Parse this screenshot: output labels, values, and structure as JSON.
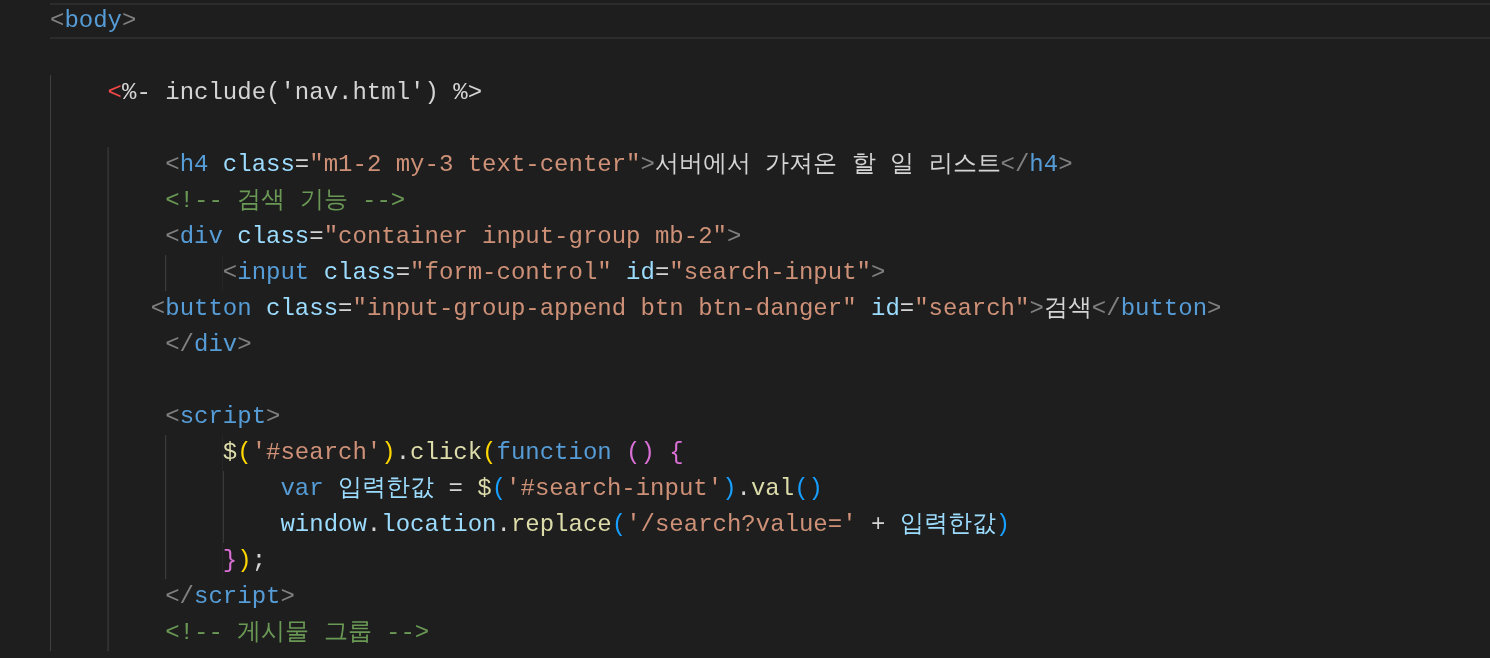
{
  "editor": {
    "lines": [
      {
        "kind": "code",
        "tokens": [
          {
            "kind": "punct",
            "text": "<"
          },
          {
            "kind": "tag",
            "text": "body"
          },
          {
            "kind": "punct",
            "text": ">"
          }
        ]
      },
      {
        "kind": "blank"
      },
      {
        "kind": "code",
        "tokens": [
          {
            "kind": "ejs",
            "text": "    <"
          },
          {
            "kind": "text",
            "text": "%- include('nav.html') %>"
          }
        ]
      },
      {
        "kind": "blank"
      },
      {
        "kind": "code",
        "tokens": [
          {
            "kind": "punct",
            "text": "        <"
          },
          {
            "kind": "tag",
            "text": "h4"
          },
          {
            "kind": "attr",
            "text": " class"
          },
          {
            "kind": "text",
            "text": "="
          },
          {
            "kind": "string",
            "text": "\"m1-2 my-3 text-center\""
          },
          {
            "kind": "punct",
            "text": ">"
          },
          {
            "kind": "text",
            "text": "서버에서 가져온 할 일 리스트"
          },
          {
            "kind": "punct",
            "text": "</"
          },
          {
            "kind": "tag",
            "text": "h4"
          },
          {
            "kind": "punct",
            "text": ">"
          }
        ]
      },
      {
        "kind": "code",
        "tokens": [
          {
            "kind": "comment",
            "text": "        <!-- 검색 기능 -->"
          }
        ]
      },
      {
        "kind": "code",
        "tokens": [
          {
            "kind": "punct",
            "text": "        <"
          },
          {
            "kind": "tag",
            "text": "div"
          },
          {
            "kind": "attr",
            "text": " class"
          },
          {
            "kind": "text",
            "text": "="
          },
          {
            "kind": "string",
            "text": "\"container input-group mb-2\""
          },
          {
            "kind": "punct",
            "text": ">"
          }
        ]
      },
      {
        "kind": "code",
        "tokens": [
          {
            "kind": "punct",
            "text": "            <"
          },
          {
            "kind": "tag",
            "text": "input"
          },
          {
            "kind": "attr",
            "text": " class"
          },
          {
            "kind": "text",
            "text": "="
          },
          {
            "kind": "string",
            "text": "\"form-control\""
          },
          {
            "kind": "attr",
            "text": " id"
          },
          {
            "kind": "text",
            "text": "="
          },
          {
            "kind": "string",
            "text": "\"search-input\""
          },
          {
            "kind": "punct",
            "text": ">"
          }
        ]
      },
      {
        "kind": "code",
        "tokens": [
          {
            "kind": "punct",
            "text": "       <"
          },
          {
            "kind": "tag",
            "text": "button"
          },
          {
            "kind": "attr",
            "text": " class"
          },
          {
            "kind": "text",
            "text": "="
          },
          {
            "kind": "string",
            "text": "\"input-group-append btn btn-danger\""
          },
          {
            "kind": "attr",
            "text": " id"
          },
          {
            "kind": "text",
            "text": "="
          },
          {
            "kind": "string",
            "text": "\"search\""
          },
          {
            "kind": "punct",
            "text": ">"
          },
          {
            "kind": "text",
            "text": "검색"
          },
          {
            "kind": "punct",
            "text": "</"
          },
          {
            "kind": "tag",
            "text": "button"
          },
          {
            "kind": "punct",
            "text": ">"
          }
        ]
      },
      {
        "kind": "code",
        "tokens": [
          {
            "kind": "punct",
            "text": "        </"
          },
          {
            "kind": "tag",
            "text": "div"
          },
          {
            "kind": "punct",
            "text": ">"
          }
        ]
      },
      {
        "kind": "blank"
      },
      {
        "kind": "code",
        "tokens": [
          {
            "kind": "punct",
            "text": "        <"
          },
          {
            "kind": "tag",
            "text": "script"
          },
          {
            "kind": "punct",
            "text": ">"
          }
        ]
      },
      {
        "kind": "code",
        "tokens": [
          {
            "kind": "fn",
            "text": "            $"
          },
          {
            "kind": "bracket1",
            "text": "("
          },
          {
            "kind": "string",
            "text": "'#search'"
          },
          {
            "kind": "bracket1",
            "text": ")"
          },
          {
            "kind": "text",
            "text": "."
          },
          {
            "kind": "fn",
            "text": "click"
          },
          {
            "kind": "bracket1",
            "text": "("
          },
          {
            "kind": "keyword",
            "text": "function"
          },
          {
            "kind": "bracket2",
            "text": " ()"
          },
          {
            "kind": "bracket2",
            "text": " {"
          }
        ]
      },
      {
        "kind": "code",
        "tokens": [
          {
            "kind": "keyword",
            "text": "                var"
          },
          {
            "kind": "var",
            "text": " 입력한값"
          },
          {
            "kind": "text",
            "text": " = "
          },
          {
            "kind": "fn",
            "text": "$"
          },
          {
            "kind": "bracket3",
            "text": "("
          },
          {
            "kind": "string",
            "text": "'#search-input'"
          },
          {
            "kind": "bracket3",
            "text": ")"
          },
          {
            "kind": "text",
            "text": "."
          },
          {
            "kind": "fn",
            "text": "val"
          },
          {
            "kind": "bracket3",
            "text": "()"
          }
        ]
      },
      {
        "kind": "code",
        "tokens": [
          {
            "kind": "var",
            "text": "                window"
          },
          {
            "kind": "text",
            "text": "."
          },
          {
            "kind": "var",
            "text": "location"
          },
          {
            "kind": "text",
            "text": "."
          },
          {
            "kind": "fn",
            "text": "replace"
          },
          {
            "kind": "bracket3",
            "text": "("
          },
          {
            "kind": "string",
            "text": "'/search?value='"
          },
          {
            "kind": "text",
            "text": " + "
          },
          {
            "kind": "var",
            "text": "입력한값"
          },
          {
            "kind": "bracket3",
            "text": ")"
          }
        ]
      },
      {
        "kind": "code",
        "tokens": [
          {
            "kind": "bracket2",
            "text": "            }"
          },
          {
            "kind": "bracket1",
            "text": ")"
          },
          {
            "kind": "text",
            "text": ";"
          }
        ]
      },
      {
        "kind": "code",
        "tokens": [
          {
            "kind": "punct",
            "text": "        </"
          },
          {
            "kind": "tag",
            "text": "script"
          },
          {
            "kind": "punct",
            "text": ">"
          }
        ]
      },
      {
        "kind": "code",
        "tokens": [
          {
            "kind": "comment",
            "text": "        <!-- 게시물 그룹 -->"
          }
        ]
      }
    ]
  }
}
